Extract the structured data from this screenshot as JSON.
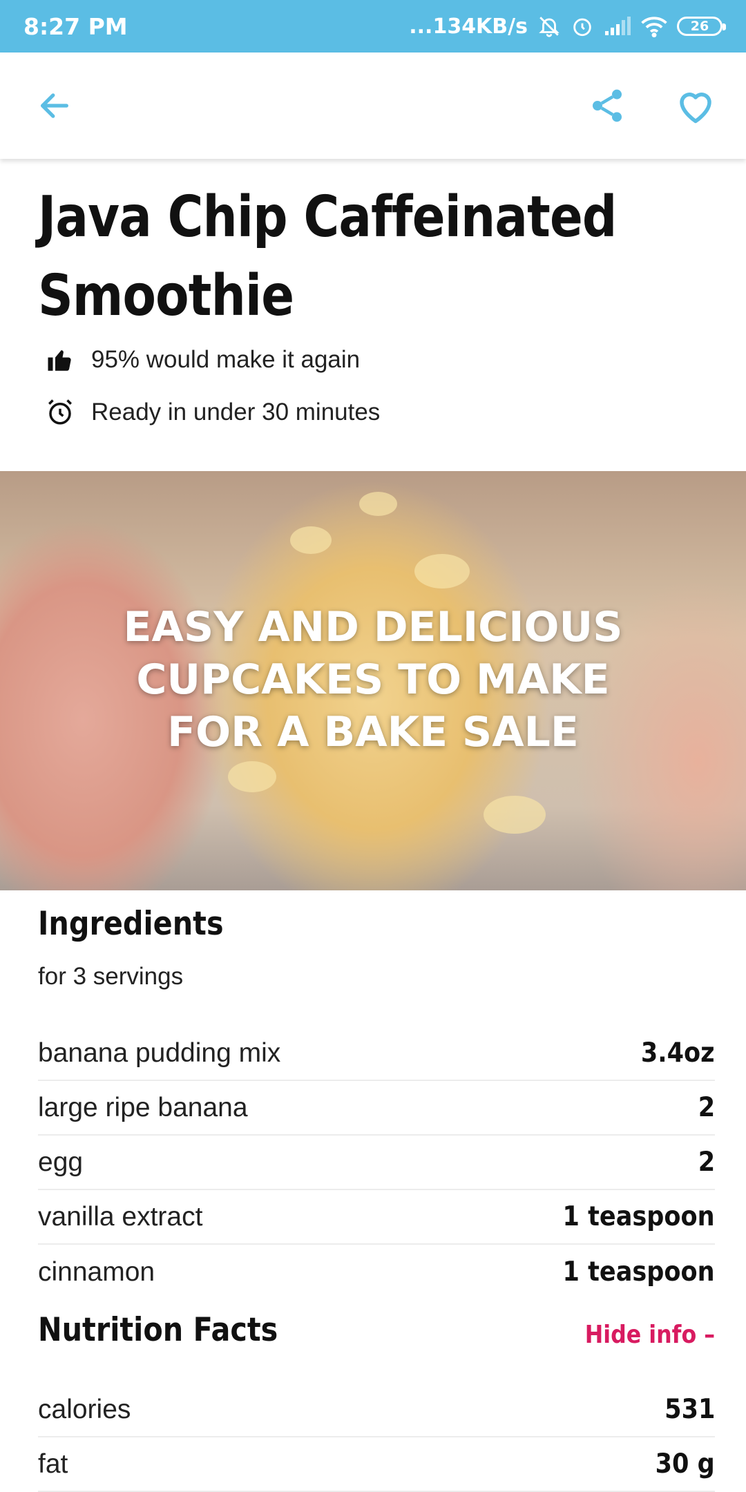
{
  "status_bar": {
    "time": "8:27 PM",
    "network_speed": "...134KB/s",
    "battery_level": "26"
  },
  "app_bar": {
    "back_icon": "arrow-left-icon",
    "share_icon": "share-icon",
    "favorite_icon": "heart-outline-icon",
    "accent_color": "#5bbde4"
  },
  "recipe": {
    "title": "Java Chip Caffeinated Smoothie",
    "rating_text": "95% would make it again",
    "time_text": "Ready in under 30 minutes"
  },
  "hero": {
    "caption_line1": "EASY AND DELICIOUS",
    "caption_line2": "CUPCAKES TO MAKE",
    "caption_line3": "FOR A BAKE SALE"
  },
  "ingredients": {
    "heading": "Ingredients",
    "servings": "for 3 servings",
    "items": [
      {
        "name": "banana pudding mix",
        "qty": "3.4oz"
      },
      {
        "name": "large ripe banana",
        "qty": "2"
      },
      {
        "name": "egg",
        "qty": "2"
      },
      {
        "name": "vanilla extract",
        "qty": "1 teaspoon"
      },
      {
        "name": "cinnamon",
        "qty": "1 teaspoon"
      }
    ]
  },
  "nutrition": {
    "heading": "Nutrition Facts",
    "toggle_label": "Hide info –",
    "toggle_color": "#d81b60",
    "items": [
      {
        "name": "calories",
        "qty": "531"
      },
      {
        "name": "fat",
        "qty": "30 g"
      }
    ]
  }
}
